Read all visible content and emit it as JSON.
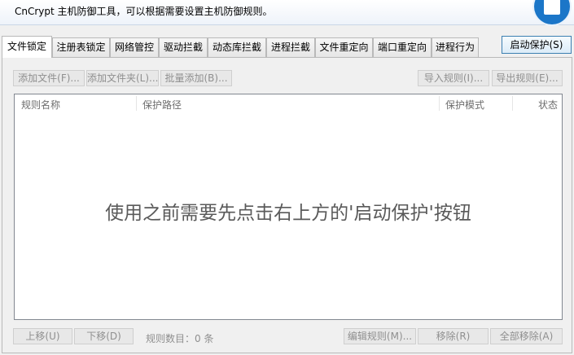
{
  "window": {
    "title": "CnCrypt 主机防御工具，可以根据需要设置主机防御规则。",
    "logo_icon": "app-logo-icon",
    "accent_color": "#1b76c8"
  },
  "tabs": [
    {
      "label": "文件锁定",
      "active": true
    },
    {
      "label": "注册表锁定"
    },
    {
      "label": "网络管控"
    },
    {
      "label": "驱动拦截"
    },
    {
      "label": "动态库拦截"
    },
    {
      "label": "进程拦截"
    },
    {
      "label": "文件重定向"
    },
    {
      "label": "端口重定向"
    },
    {
      "label": "进程行为"
    }
  ],
  "start_button": "启动保护(S)",
  "toolbar": {
    "add_file": "添加文件(F)...",
    "add_folder": "添加文件夹(L)...",
    "batch_add": "批量添加(B)...",
    "import_rules": "导入规则(I)...",
    "export_rules": "导出规则(E)..."
  },
  "list": {
    "columns": [
      "规则名称",
      "保护路径",
      "保护模式",
      "状态"
    ],
    "rows": [],
    "empty_message": "使用之前需要先点击右上方的'启动保护'按钮"
  },
  "footer": {
    "move_up": "上移(U)",
    "move_down": "下移(D)",
    "rule_count_label": "规则数目：0 条",
    "edit_rule": "编辑规则(M)...",
    "remove": "移除(R)",
    "remove_all": "全部移除(A)"
  }
}
